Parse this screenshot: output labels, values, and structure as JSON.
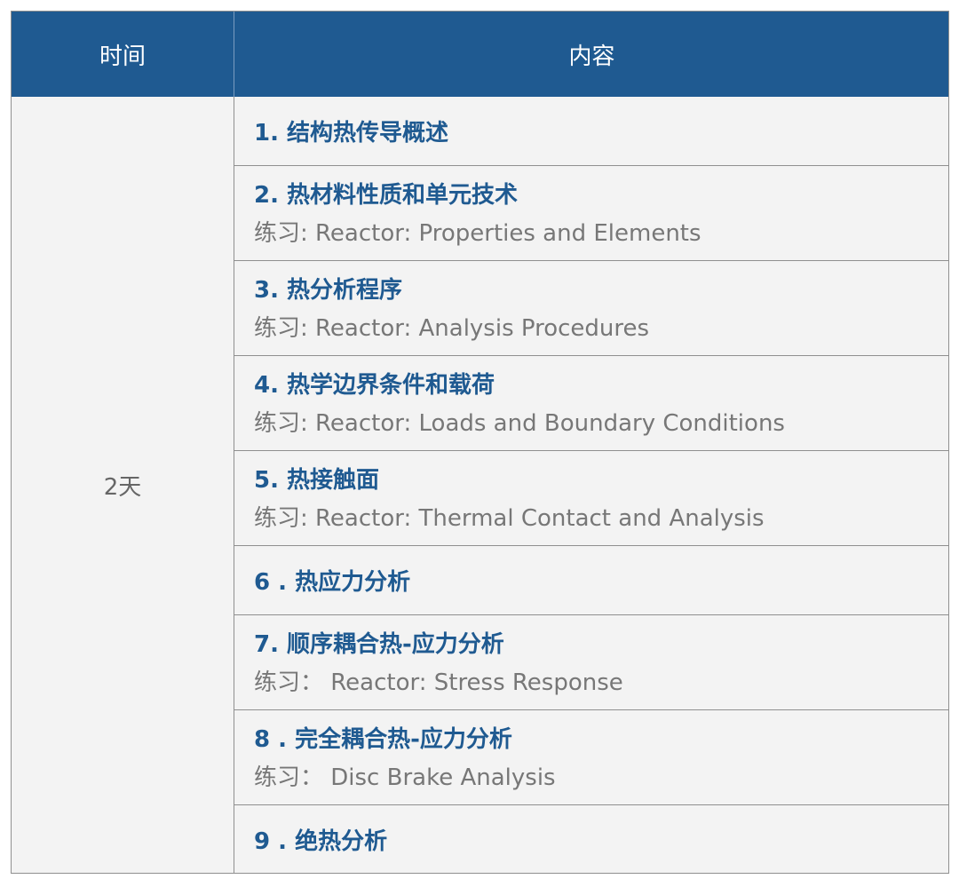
{
  "table": {
    "header": {
      "time": "时间",
      "content": "内容"
    },
    "duration": "2天",
    "rows": [
      {
        "title": "1. 结构热传导概述",
        "exercise": ""
      },
      {
        "title": "2. 热材料性质和单元技术",
        "exercise": "练习: Reactor: Properties and Elements"
      },
      {
        "title": "3. 热分析程序",
        "exercise": "练习: Reactor: Analysis Procedures"
      },
      {
        "title": "4. 热学边界条件和载荷",
        "exercise": "练习: Reactor: Loads and Boundary Conditions"
      },
      {
        "title": "5. 热接触面",
        "exercise": "练习:  Reactor: Thermal Contact and Analysis"
      },
      {
        "title": "6 . 热应力分析",
        "exercise": ""
      },
      {
        "title": "7. 顺序耦合热-应力分析",
        "exercise": "练习：  Reactor: Stress Response"
      },
      {
        "title": "8 . 完全耦合热-应力分析",
        "exercise": "练习：  Disc Brake Analysis"
      },
      {
        "title": "9 . 绝热分析",
        "exercise": ""
      }
    ],
    "colors": {
      "header_bg": "#1f5a91",
      "header_text": "#ffffff",
      "title_text": "#1f5a91",
      "exercise_text": "#777777",
      "cell_bg": "#f3f3f3",
      "border": "#8f8f8f"
    }
  }
}
